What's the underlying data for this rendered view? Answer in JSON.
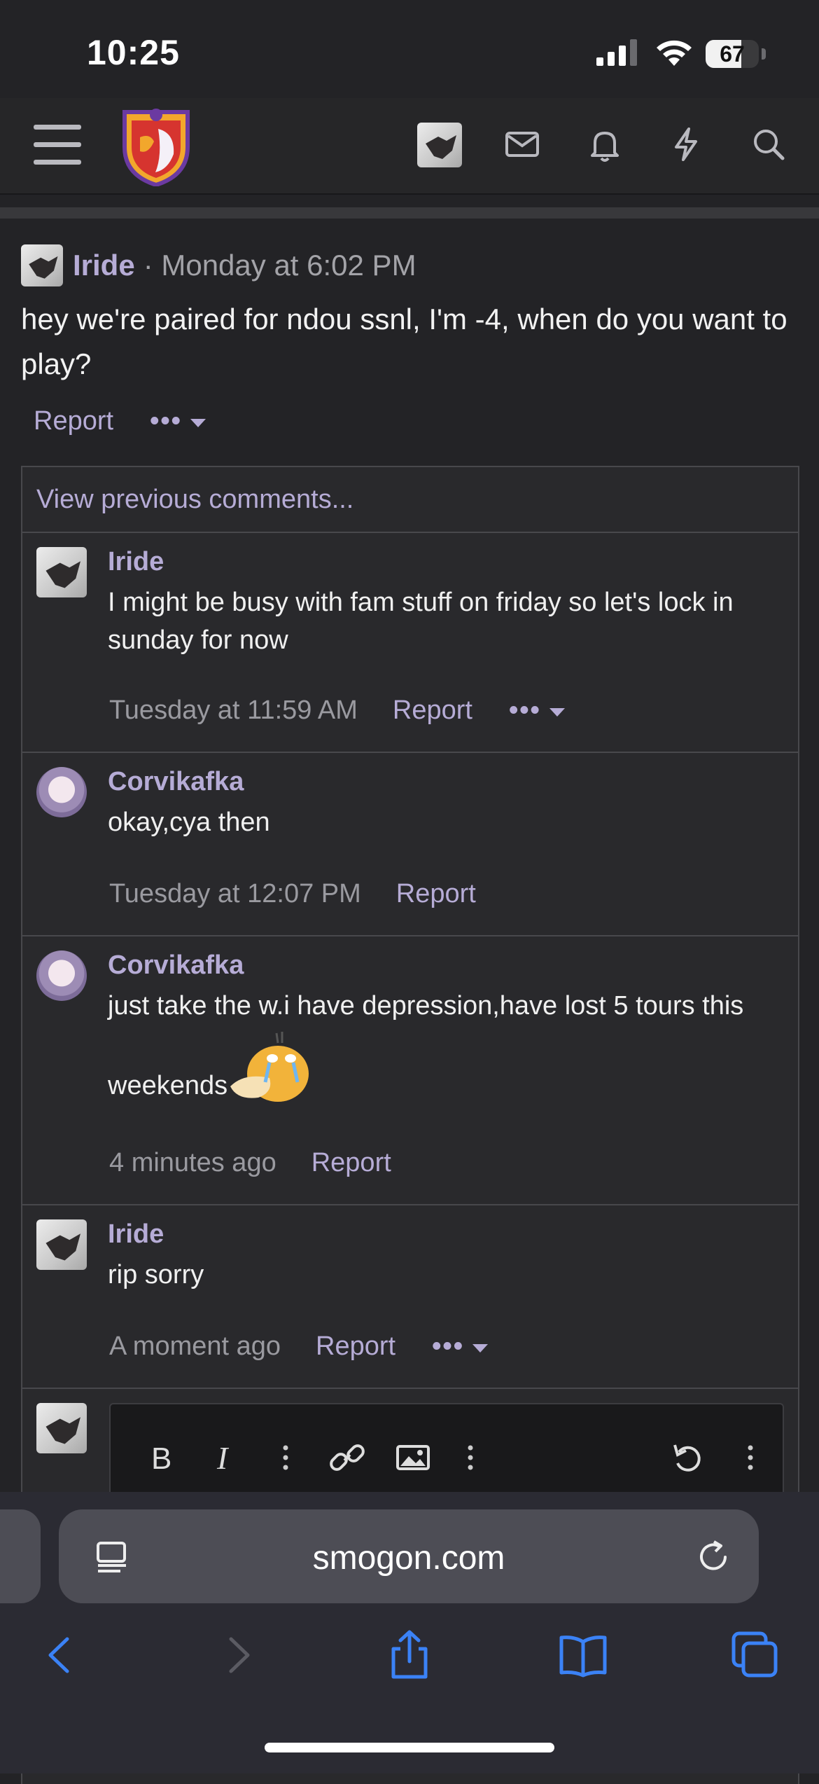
{
  "status_bar": {
    "time": "10:25",
    "battery": "67",
    "battery_level": 0.67
  },
  "nav": {
    "menu_icon": "hamburger-menu-icon",
    "logo": "smogon-logo",
    "icons": [
      "avatar",
      "envelope-icon",
      "bell-icon",
      "lightning-icon",
      "search-icon"
    ]
  },
  "post": {
    "author": "Iride",
    "time": "· Monday at 6:02 PM",
    "body": "hey we're paired for ndou ssnl, I'm -4, when do you want to play?",
    "report": "Report",
    "more": "•••"
  },
  "comments": {
    "view_previous": "View previous comments...",
    "items": [
      {
        "author": "Iride",
        "text": "I might be busy with fam stuff on friday so let's lock in sunday for now",
        "time": "Tuesday at 11:59 AM",
        "report": "Report",
        "more": "•••"
      },
      {
        "author": "Corvikafka",
        "text": "okay,cya then",
        "time": "Tuesday at 12:07 PM",
        "report": "Report"
      },
      {
        "author": "Corvikafka",
        "text_line1": "just take the w.i have depression,have lost 5 tours this",
        "text_line2": "weekends",
        "emoji": "crying-psyduck-emoji",
        "time": "4 minutes ago",
        "report": "Report"
      },
      {
        "author": "Iride",
        "text": "rip sorry",
        "time": "A moment ago",
        "report": "Report",
        "more": "•••"
      }
    ]
  },
  "editor": {
    "toolbar": [
      "bold-icon",
      "italic-icon",
      "more-vertical-icon",
      "link-icon",
      "image-icon",
      "more-vertical-icon",
      "undo-icon",
      "more-vertical-icon"
    ]
  },
  "browser": {
    "url": "smogon.com",
    "buttons": [
      "back-icon",
      "forward-icon",
      "share-icon",
      "bookmarks-icon",
      "tabs-icon"
    ],
    "accent": "#3b82f6"
  }
}
